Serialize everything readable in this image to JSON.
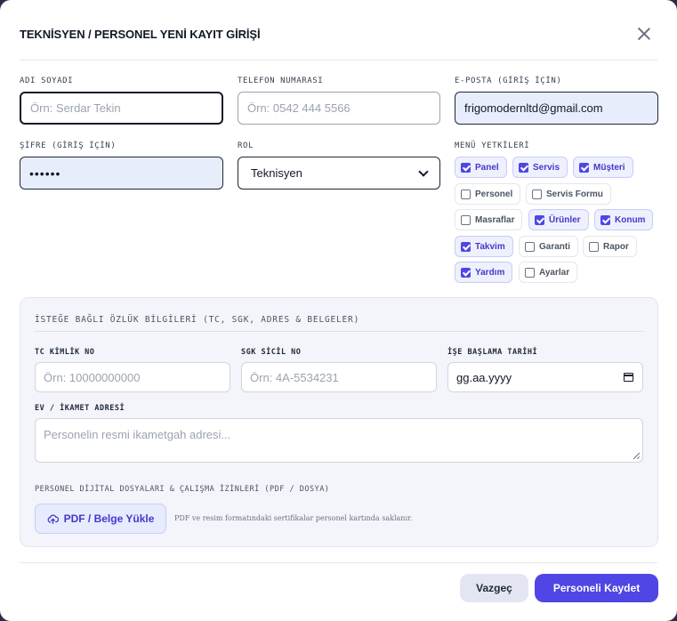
{
  "modal": {
    "title": "TEKNİSYEN / PERSONEL YENİ KAYIT GİRİŞİ"
  },
  "form": {
    "name": {
      "label": "ADI SOYADI",
      "placeholder": "Örn: Serdar Tekin",
      "value": ""
    },
    "phone": {
      "label": "TELEFON NUMARASI",
      "placeholder": "Örn: 0542 444 5566",
      "value": ""
    },
    "email": {
      "label": "E-POSTA (GİRİŞ İÇİN)",
      "value": "frigomodernltd@gmail.com"
    },
    "password": {
      "label": "ŞİFRE (GİRİŞ İÇİN)",
      "value": "••••••"
    },
    "role": {
      "label": "ROL",
      "value": "Teknisyen"
    },
    "permissions": {
      "label": "MENÜ YETKİLERİ",
      "items": [
        {
          "label": "Panel",
          "checked": true
        },
        {
          "label": "Servis",
          "checked": true
        },
        {
          "label": "Müşteri",
          "checked": true
        },
        {
          "label": "Personel",
          "checked": false
        },
        {
          "label": "Servis Formu",
          "checked": false
        },
        {
          "label": "Masraflar",
          "checked": false
        },
        {
          "label": "Ürünler",
          "checked": true
        },
        {
          "label": "Konum",
          "checked": true
        },
        {
          "label": "Takvim",
          "checked": true
        },
        {
          "label": "Garanti",
          "checked": false
        },
        {
          "label": "Rapor",
          "checked": false
        },
        {
          "label": "Yardım",
          "checked": true
        },
        {
          "label": "Ayarlar",
          "checked": false
        }
      ]
    }
  },
  "optional": {
    "title": "İSTEĞE BAĞLI ÖZLÜK BİLGİLERİ (TC, SGK, ADRES & BELGELER)",
    "tc": {
      "label": "TC KİMLİK NO",
      "placeholder": "Örn: 10000000000"
    },
    "sgk": {
      "label": "SGK SİCİL NO",
      "placeholder": "Örn: 4A-5534231"
    },
    "start_date": {
      "label": "İŞE BAŞLAMA TARİHİ",
      "value": "gg.aa.yyyy"
    },
    "address": {
      "label": "EV / İKAMET ADRESİ",
      "placeholder": "Personelin resmi ikametgah adresi..."
    },
    "documents": {
      "label": "PERSONEL DİJİTAL DOSYALARI & ÇALIŞMA İZİNLERİ (PDF / DOSYA)",
      "upload_label": "PDF / Belge Yükle",
      "hint": "PDF ve resim formatındaki sertifikalar personel kartında saklanır."
    }
  },
  "footer": {
    "cancel_label": "Vazgeç",
    "save_label": "Personeli Kaydet"
  },
  "colors": {
    "accent": "#4f46e5",
    "chip_on_bg": "#eef0fd",
    "filled_bg": "#e8edfc"
  }
}
